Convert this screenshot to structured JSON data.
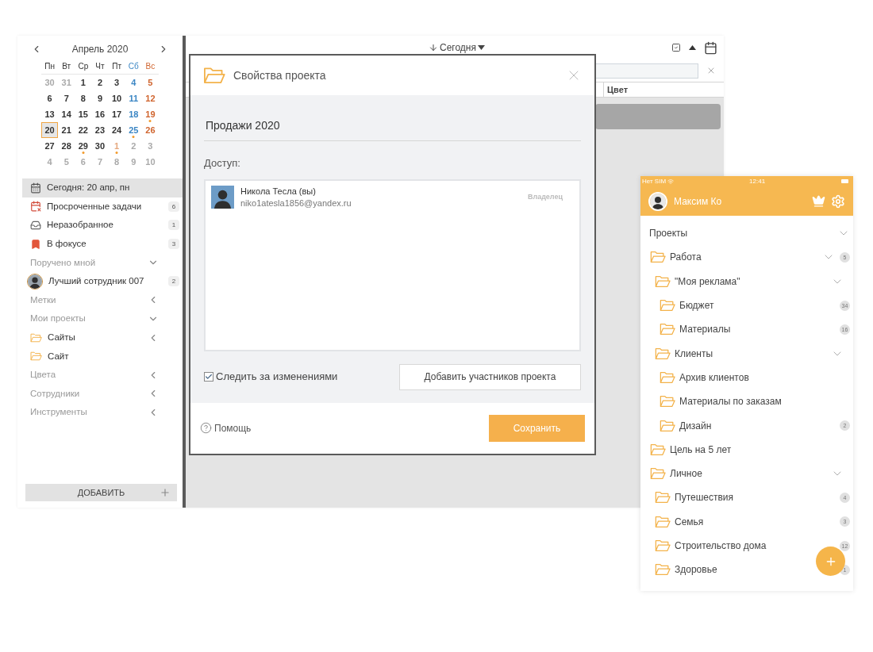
{
  "calendar": {
    "month": "Апрель 2020",
    "weekdays": [
      {
        "label": "Пн",
        "kind": "weekday"
      },
      {
        "label": "Вт",
        "kind": "weekday"
      },
      {
        "label": "Ср",
        "kind": "weekday"
      },
      {
        "label": "Чт",
        "kind": "weekday"
      },
      {
        "label": "Пт",
        "kind": "weekday"
      },
      {
        "label": "Сб",
        "kind": "saturday"
      },
      {
        "label": "Вс",
        "kind": "sunday"
      }
    ],
    "weeks": [
      [
        {
          "day": "30",
          "kind": "other",
          "selected": false,
          "marked": false
        },
        {
          "day": "31",
          "kind": "other",
          "selected": false,
          "marked": false
        },
        {
          "day": "1",
          "kind": "weekday",
          "selected": false,
          "marked": false
        },
        {
          "day": "2",
          "kind": "weekday",
          "selected": false,
          "marked": false
        },
        {
          "day": "3",
          "kind": "weekday",
          "selected": false,
          "marked": false
        },
        {
          "day": "4",
          "kind": "saturday",
          "selected": false,
          "marked": false
        },
        {
          "day": "5",
          "kind": "sunday",
          "selected": false,
          "marked": false
        }
      ],
      [
        {
          "day": "6",
          "kind": "weekday",
          "selected": false,
          "marked": false
        },
        {
          "day": "7",
          "kind": "weekday",
          "selected": false,
          "marked": false
        },
        {
          "day": "8",
          "kind": "weekday",
          "selected": false,
          "marked": false
        },
        {
          "day": "9",
          "kind": "weekday",
          "selected": false,
          "marked": false
        },
        {
          "day": "10",
          "kind": "weekday",
          "selected": false,
          "marked": false
        },
        {
          "day": "11",
          "kind": "saturday",
          "selected": false,
          "marked": false
        },
        {
          "day": "12",
          "kind": "sunday",
          "selected": false,
          "marked": false
        }
      ],
      [
        {
          "day": "13",
          "kind": "weekday",
          "selected": false,
          "marked": false
        },
        {
          "day": "14",
          "kind": "weekday",
          "selected": false,
          "marked": false
        },
        {
          "day": "15",
          "kind": "weekday",
          "selected": false,
          "marked": false
        },
        {
          "day": "16",
          "kind": "weekday",
          "selected": false,
          "marked": false
        },
        {
          "day": "17",
          "kind": "weekday",
          "selected": false,
          "marked": false
        },
        {
          "day": "18",
          "kind": "saturday",
          "selected": false,
          "marked": false
        },
        {
          "day": "19",
          "kind": "sunday",
          "selected": false,
          "marked": true
        }
      ],
      [
        {
          "day": "20",
          "kind": "weekday",
          "selected": true,
          "marked": false
        },
        {
          "day": "21",
          "kind": "weekday",
          "selected": false,
          "marked": false
        },
        {
          "day": "22",
          "kind": "weekday",
          "selected": false,
          "marked": false
        },
        {
          "day": "23",
          "kind": "weekday",
          "selected": false,
          "marked": false
        },
        {
          "day": "24",
          "kind": "weekday",
          "selected": false,
          "marked": false
        },
        {
          "day": "25",
          "kind": "saturday",
          "selected": false,
          "marked": true
        },
        {
          "day": "26",
          "kind": "sunday",
          "selected": false,
          "marked": false
        }
      ],
      [
        {
          "day": "27",
          "kind": "weekday",
          "selected": false,
          "marked": false
        },
        {
          "day": "28",
          "kind": "weekday",
          "selected": false,
          "marked": false
        },
        {
          "day": "29",
          "kind": "weekday",
          "selected": false,
          "marked": true
        },
        {
          "day": "30",
          "kind": "weekday",
          "selected": false,
          "marked": false
        },
        {
          "day": "1",
          "kind": "other_holiday",
          "selected": false,
          "marked": true
        },
        {
          "day": "2",
          "kind": "other",
          "selected": false,
          "marked": false
        },
        {
          "day": "3",
          "kind": "other",
          "selected": false,
          "marked": false
        }
      ],
      [
        {
          "day": "4",
          "kind": "other",
          "selected": false,
          "marked": false
        },
        {
          "day": "5",
          "kind": "other",
          "selected": false,
          "marked": false
        },
        {
          "day": "6",
          "kind": "other",
          "selected": false,
          "marked": false
        },
        {
          "day": "7",
          "kind": "other",
          "selected": false,
          "marked": false
        },
        {
          "day": "8",
          "kind": "other",
          "selected": false,
          "marked": false
        },
        {
          "day": "9",
          "kind": "other",
          "selected": false,
          "marked": false
        },
        {
          "day": "10",
          "kind": "other",
          "selected": false,
          "marked": false
        }
      ]
    ]
  },
  "sidebar": {
    "items": [
      {
        "kind": "today",
        "label": "Сегодня: 20 апр, пн",
        "selected": true
      },
      {
        "kind": "overdue",
        "label": "Просроченные задачи",
        "count": "6",
        "selected": false
      },
      {
        "kind": "inbox",
        "label": "Неразобранное",
        "count": "1",
        "selected": false
      },
      {
        "kind": "focus",
        "label": "В фокусе",
        "count": "3",
        "selected": false
      },
      {
        "kind": "section",
        "label": "Поручено мной",
        "expanded": true
      },
      {
        "kind": "person",
        "label": "Лучший сотрудник 007",
        "count": "2",
        "selected": false
      },
      {
        "kind": "section",
        "label": "Метки",
        "expanded": false
      },
      {
        "kind": "section",
        "label": "Мои проекты",
        "expanded": true
      },
      {
        "kind": "project",
        "label": "Сайты",
        "expanded": false,
        "selected": false
      },
      {
        "kind": "project",
        "label": "Сайт",
        "selected": false
      },
      {
        "kind": "section",
        "label": "Цвета",
        "expanded": false
      },
      {
        "kind": "section",
        "label": "Сотрудники",
        "expanded": false
      },
      {
        "kind": "section",
        "label": "Инструменты",
        "expanded": false
      }
    ],
    "add_button": "ДОБАВИТЬ"
  },
  "toolbar": {
    "sort_label": "Сегодня"
  },
  "table": {
    "columns": [
      "Цвет"
    ]
  },
  "dialog": {
    "title": "Свойства проекта",
    "project_name": "Продажи 2020",
    "access_label": "Доступ:",
    "members": [
      {
        "name": "Никола Тесла (вы)",
        "email": "niko1atesla1856@yandex.ru",
        "role": "Владелец"
      }
    ],
    "watch": {
      "label": "Следить за изменениями",
      "checked": true
    },
    "add_members_button": "Добавить участников проекта",
    "help": "Помощь",
    "save_button": "Сохранить"
  },
  "phone": {
    "status_bar": {
      "carrier": "Нет SIM",
      "time": "12:41"
    },
    "user": {
      "name": "Максим Ко"
    },
    "projects": {
      "label": "Проекты",
      "expanded": true,
      "items": [
        {
          "label": "Работа",
          "count": "5",
          "expanded": true,
          "children": [
            {
              "label": "\"Моя реклама\"",
              "expanded": true,
              "children": [
                {
                  "label": "Бюджет",
                  "count": "34"
                },
                {
                  "label": "Материалы",
                  "count": "16"
                }
              ]
            },
            {
              "label": "Клиенты",
              "expanded": true,
              "children": [
                {
                  "label": "Архив клиентов"
                },
                {
                  "label": "Материалы по заказам"
                },
                {
                  "label": "Дизайн",
                  "count": "2"
                }
              ]
            }
          ]
        },
        {
          "label": "Цель на 5 лет"
        },
        {
          "label": "Личное",
          "expanded": true,
          "children": [
            {
              "label": "Путешествия",
              "count": "4"
            },
            {
              "label": "Семья",
              "count": "3"
            },
            {
              "label": "Строительство дома",
              "count": "12"
            },
            {
              "label": "Здоровье",
              "count": "1"
            }
          ]
        }
      ]
    }
  }
}
